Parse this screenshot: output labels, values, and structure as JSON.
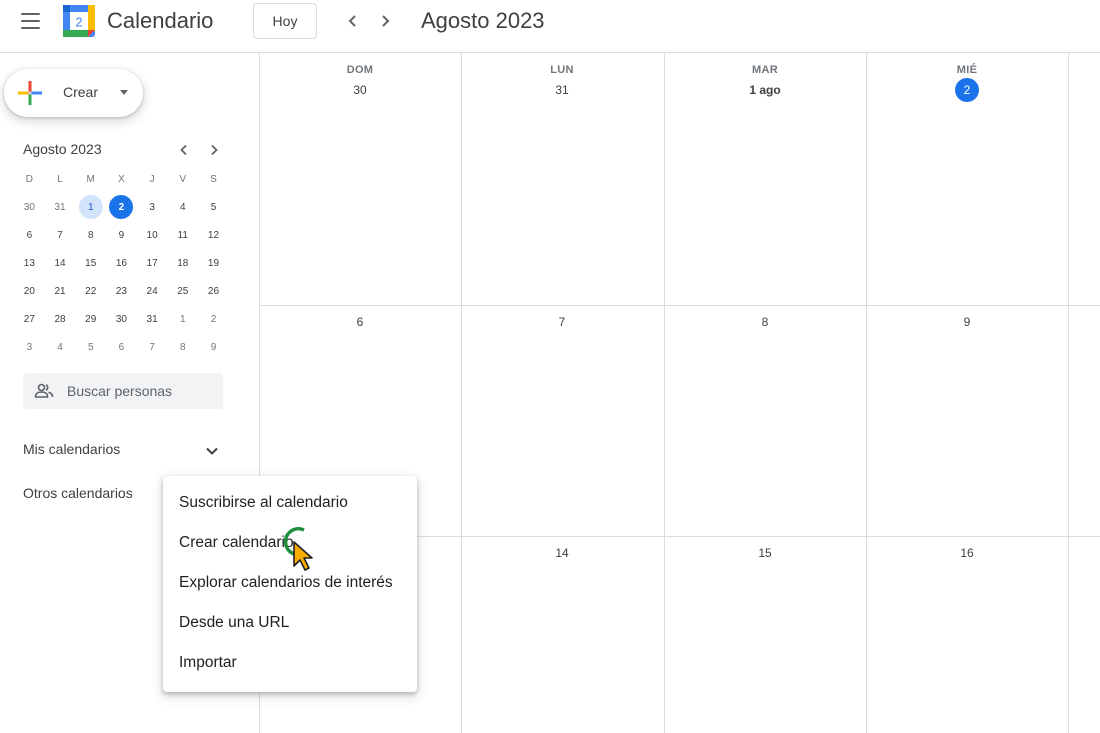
{
  "header": {
    "app_title": "Calendario",
    "today_button": "Hoy",
    "current_period": "Agosto 2023",
    "logo_day": "2"
  },
  "sidebar": {
    "create_label": "Crear",
    "mini_calendar": {
      "title": "Agosto 2023",
      "weekdays": [
        "D",
        "L",
        "M",
        "X",
        "J",
        "V",
        "S"
      ],
      "weeks": [
        [
          "30",
          "31",
          "1",
          "2",
          "3",
          "4",
          "5"
        ],
        [
          "6",
          "7",
          "8",
          "9",
          "10",
          "11",
          "12"
        ],
        [
          "13",
          "14",
          "15",
          "16",
          "17",
          "18",
          "19"
        ],
        [
          "20",
          "21",
          "22",
          "23",
          "24",
          "25",
          "26"
        ],
        [
          "27",
          "28",
          "29",
          "30",
          "31",
          "1",
          "2"
        ],
        [
          "3",
          "4",
          "5",
          "6",
          "7",
          "8",
          "9"
        ]
      ]
    },
    "search_placeholder": "Buscar personas",
    "my_calendars": "Mis calendarios",
    "other_calendars": "Otros calendarios"
  },
  "month_view": {
    "day_headers": [
      "DOM",
      "LUN",
      "MAR",
      "MIÉ"
    ],
    "week1": [
      "30",
      "31",
      "1 ago",
      "2"
    ],
    "week2": [
      "6",
      "7",
      "8",
      "9"
    ],
    "week3": [
      "14",
      "15",
      "16"
    ]
  },
  "menu": {
    "items": [
      "Suscribirse al calendario",
      "Crear calendario",
      "Explorar calendarios de interés",
      "Desde una URL",
      "Importar"
    ]
  },
  "colors": {
    "accent": "#1a73e8",
    "selected_day_bg": "#d2e3fc",
    "grid_line": "#dadce0",
    "cursor_fill": "#f9ab00",
    "click_ring": "#1e8e3e"
  }
}
